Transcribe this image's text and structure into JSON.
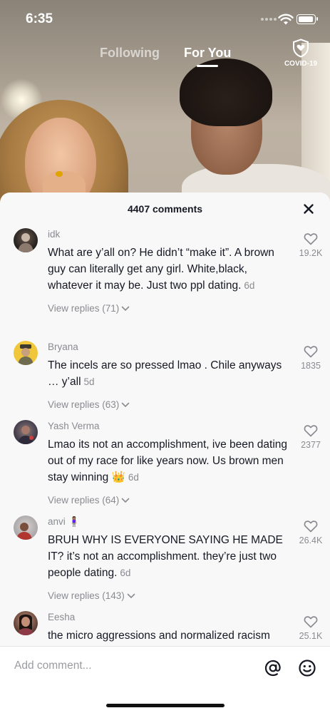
{
  "status_bar": {
    "time": "6:35"
  },
  "top_nav": {
    "tabs": [
      {
        "label": "Following",
        "active": false
      },
      {
        "label": "For You",
        "active": true
      }
    ],
    "covid_label": "COVID-19"
  },
  "comments_sheet": {
    "count_label": "4407 comments",
    "comments": [
      {
        "username": "idk",
        "text": "What are y’all on? He didn’t “make it”. A brown guy can literally get any girl. White,black, whatever it may be. Just two ppl dating.",
        "time_ago": "6d",
        "replies_label": "View replies (71)",
        "likes": "19.2K"
      },
      {
        "username": "Bryana",
        "text": "The incels are so pressed lmao . Chile anyways … y’all",
        "time_ago": "5d",
        "replies_label": "View replies (63)",
        "likes": "1835"
      },
      {
        "username": "Yash Verma",
        "text": "Lmao its not an accomplishment, ive been dating out of my race for like years now. Us brown men stay winning 👑",
        "time_ago": "6d",
        "replies_label": "View replies (64)",
        "likes": "2377"
      },
      {
        "username": "anvi 🧍🏽‍♀️",
        "text": "BRUH WHY IS EVERYONE SAYING HE MADE IT? it’s not an accomplishment. they’re just two people dating.",
        "time_ago": "6d",
        "replies_label": "View replies (143)",
        "likes": "26.4K"
      },
      {
        "username": "Eesha",
        "text": "the micro aggressions and normalized racism",
        "time_ago": "",
        "replies_label": "",
        "likes": "25.1K"
      }
    ]
  },
  "composer": {
    "placeholder": "Add comment..."
  },
  "colors": {
    "text": "#161823",
    "muted": "#8a8b91",
    "sheet_bg": "#f8f8f8"
  }
}
